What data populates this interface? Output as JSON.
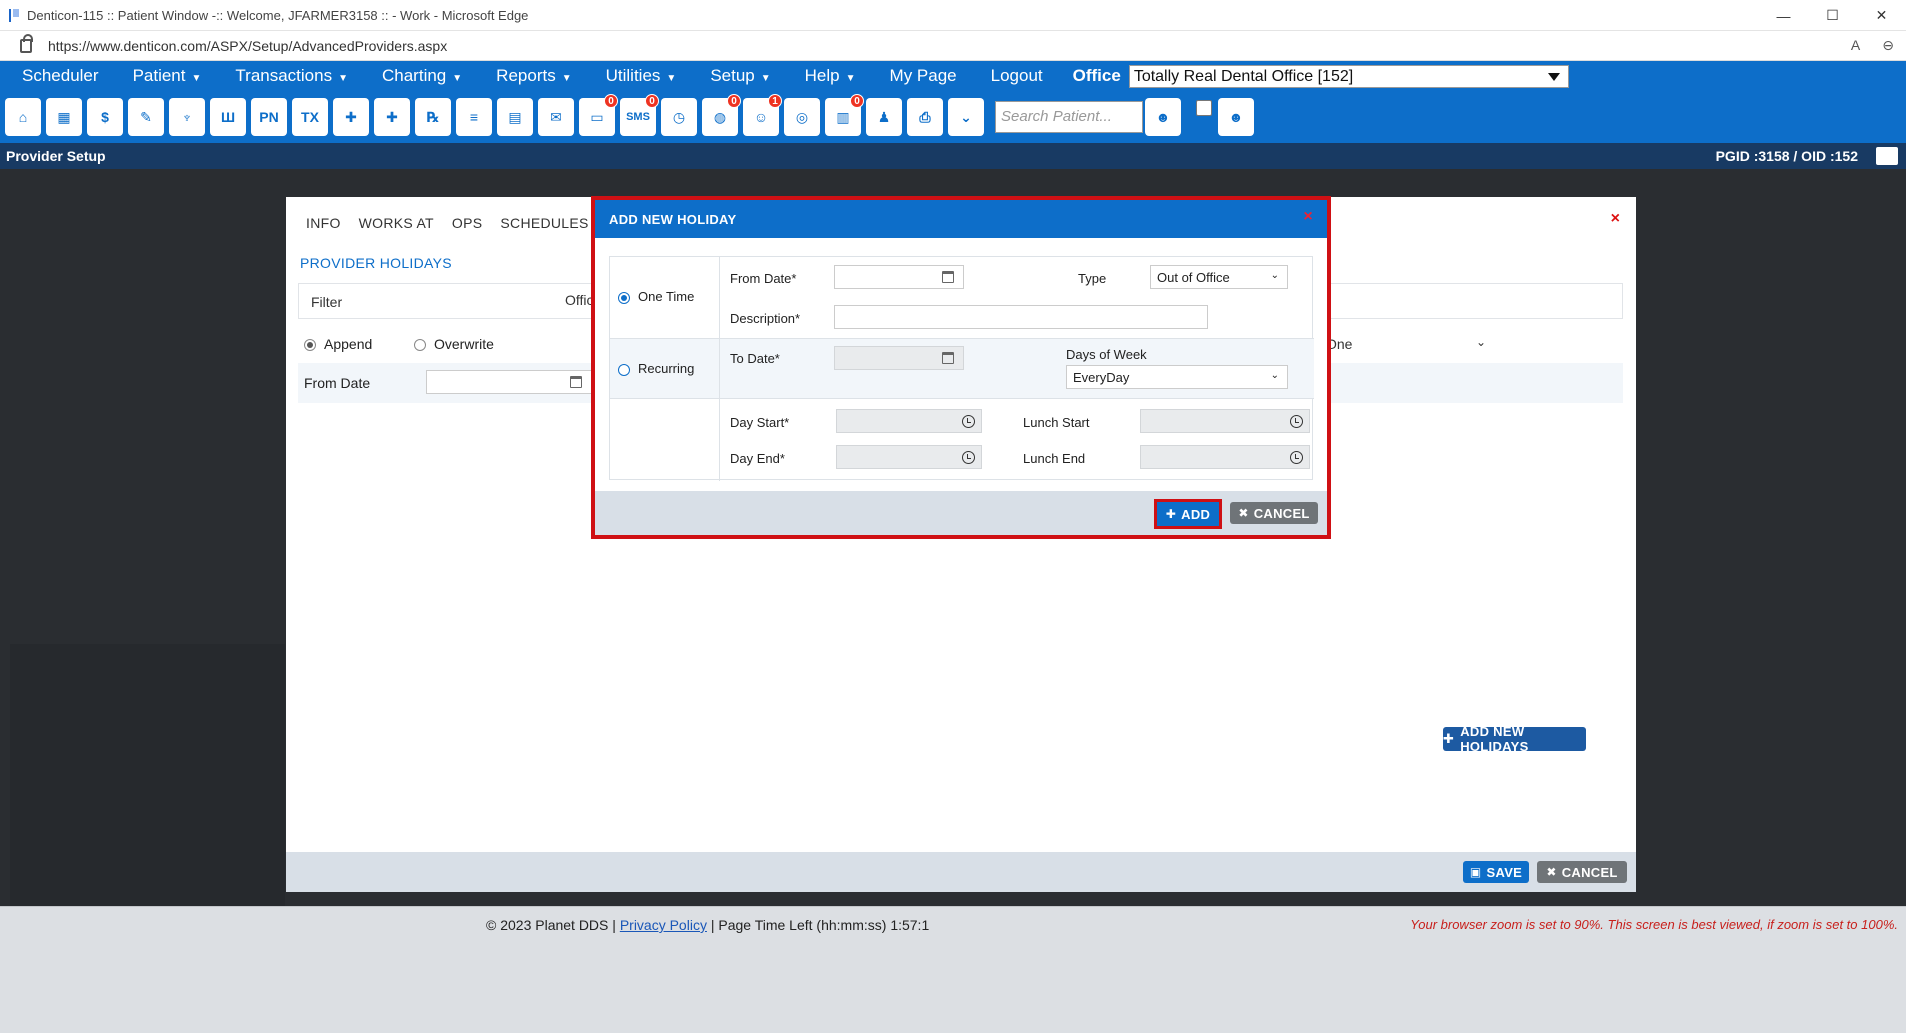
{
  "browser": {
    "window_title": "Denticon-115 :: Patient Window -:: Welcome, JFARMER3158 :: - Work - Microsoft Edge",
    "url": "https://www.denticon.com/ASPX/Setup/AdvancedProviders.aspx",
    "controls": [
      "—",
      "☐",
      "✕"
    ]
  },
  "menu": {
    "items": [
      "Scheduler",
      "Patient",
      "Transactions",
      "Charting",
      "Reports",
      "Utilities",
      "Setup",
      "Help",
      "My Page",
      "Logout"
    ],
    "office_label": "Office",
    "office_value": "Totally Real Dental Office [152]"
  },
  "toolbar": {
    "icons": [
      {
        "name": "home-icon",
        "glyph": "⌂"
      },
      {
        "name": "calendar-icon",
        "glyph": "▦"
      },
      {
        "name": "dollar-icon",
        "glyph": "$"
      },
      {
        "name": "edit-icon",
        "glyph": "✎"
      },
      {
        "name": "tooth-icon",
        "glyph": "♆"
      },
      {
        "name": "teeth-chart-icon",
        "glyph": "Ш"
      },
      {
        "name": "pn-icon",
        "glyph": "PN"
      },
      {
        "name": "tx-icon",
        "glyph": "TX"
      },
      {
        "name": "add-patient-icon",
        "glyph": "✚"
      },
      {
        "name": "add-family-icon",
        "glyph": "✚"
      },
      {
        "name": "rx-icon",
        "glyph": "℞"
      },
      {
        "name": "notes-icon",
        "glyph": "≡"
      },
      {
        "name": "fax-icon",
        "glyph": "▤"
      },
      {
        "name": "mail-icon",
        "glyph": "✉"
      },
      {
        "name": "messages-icon",
        "glyph": "▭",
        "badge": "0"
      },
      {
        "name": "sms-icon",
        "glyph": "SMS",
        "badge": "0"
      },
      {
        "name": "clock-icon",
        "glyph": "◷"
      },
      {
        "name": "web-icon",
        "glyph": "◍",
        "badge": "0"
      },
      {
        "name": "support-icon",
        "glyph": "☺",
        "badge": "1"
      },
      {
        "name": "globe-icon",
        "glyph": "◎"
      },
      {
        "name": "forms-icon",
        "glyph": "▥",
        "badge": "0"
      },
      {
        "name": "group-icon",
        "glyph": "♟"
      },
      {
        "name": "print-icon",
        "glyph": "⎙"
      },
      {
        "name": "collapse-icon",
        "glyph": "⌄"
      }
    ],
    "search_placeholder": "Search Patient...",
    "search_user_icon": "person-search-icon",
    "group_search_icon": "group-search-icon"
  },
  "status": {
    "page_title": "Provider Setup",
    "ids": "PGID :3158  /  OID :152"
  },
  "provider_dialog": {
    "tabs": [
      "INFO",
      "WORKS AT",
      "OPS",
      "SCHEDULES"
    ],
    "section_title": "PROVIDER HOLIDAYS",
    "filter_label": "Filter",
    "office_label": "Office",
    "append_label": "Append",
    "overwrite_label": "Overwrite",
    "from_date_label": "From Date",
    "one_label": "One",
    "add_new_holidays": "ADD NEW HOLIDAYS",
    "save": "SAVE",
    "cancel": "CANCEL"
  },
  "holiday_modal": {
    "title": "ADD NEW HOLIDAY",
    "one_time": "One Time",
    "recurring": "Recurring",
    "from_date": "From Date*",
    "type_label": "Type",
    "type_value": "Out of Office",
    "description": "Description*",
    "to_date": "To Date*",
    "days_of_week_label": "Days of Week",
    "days_of_week_value": "EveryDay",
    "day_start": "Day Start*",
    "day_end": "Day End*",
    "lunch_start": "Lunch Start",
    "lunch_end": "Lunch End",
    "add": "ADD",
    "cancel": "CANCEL"
  },
  "footer": {
    "copyright": "© 2023 Planet DDS | ",
    "privacy": "Privacy Policy",
    "time_left": " |  Page Time Left (hh:mm:ss) 1:57:1",
    "zoom_note": "Your browser zoom is set to 90%. This screen is best viewed, if zoom is set to 100%."
  }
}
